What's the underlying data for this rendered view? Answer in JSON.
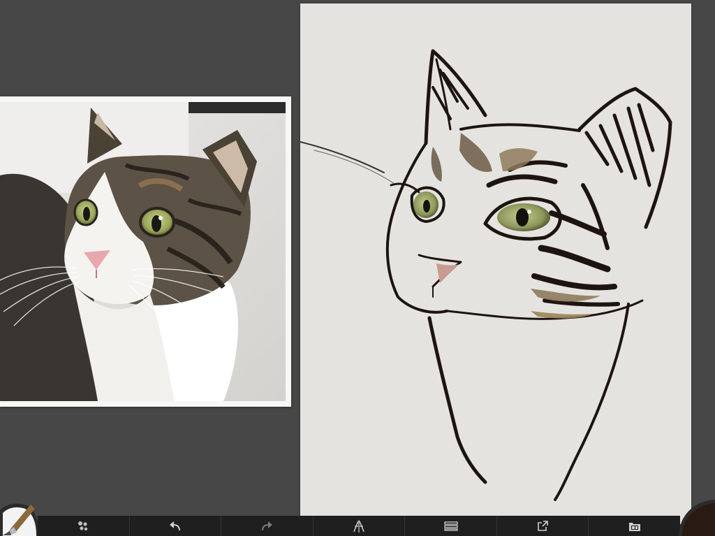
{
  "app": {
    "background": "#474747"
  },
  "reference": {
    "subject": "tabby-and-white-cat-photo"
  },
  "canvas": {
    "paper_color": "#e4e3e0",
    "stroke_color": "#1e140f"
  },
  "toolbar": {
    "buttons": [
      {
        "name": "brush-size-icon"
      },
      {
        "name": "undo-icon"
      },
      {
        "name": "redo-icon"
      },
      {
        "name": "symmetry-icon"
      },
      {
        "name": "layers-icon"
      },
      {
        "name": "share-icon"
      },
      {
        "name": "gallery-icon"
      }
    ]
  },
  "color_puck": {
    "current_color": "#2a1a14"
  }
}
